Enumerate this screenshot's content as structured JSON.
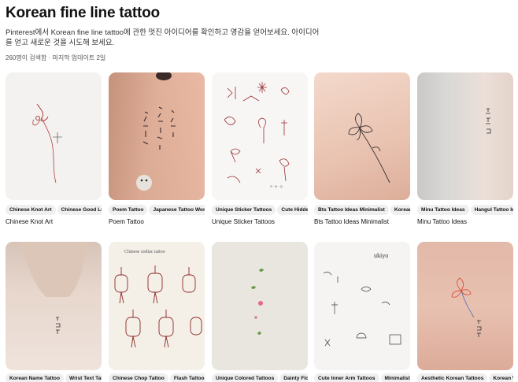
{
  "header": {
    "title": "Korean fine line tattoo",
    "description": "Pinterest에서 Korean fine line tattoo에 관한 멋진 아이디어를 확인하고 영감을 얻어보세요. 아이디어를 얻고 새로운 것을 시도해 보세요.",
    "meta": "260명이 검색함 · 마지막 업데이트 2일"
  },
  "cards": [
    {
      "chips": [
        "Chinese Knot Art",
        "Chinese Good Luck"
      ],
      "label": "Chinese Knot Art"
    },
    {
      "chips": [
        "Poem Tattoo",
        "Japanese Tattoo Words"
      ],
      "label": "Poem Tattoo"
    },
    {
      "chips": [
        "Unique Sticker Tattoos",
        "Cute Hidden"
      ],
      "label": "Unique Sticker Tattoos"
    },
    {
      "chips": [
        "Bts Tattoo Ideas Minimalist",
        "Korean"
      ],
      "label": "Bts Tattoo Ideas Minimalist"
    },
    {
      "chips": [
        "Minu Tattoo Ideas",
        "Hangul Tattoo Ideas"
      ],
      "label": "Minu Tattoo Ideas"
    },
    {
      "chips": [
        "Korean Name Tattoo",
        "Wrist Text Tattoo"
      ],
      "label": ""
    },
    {
      "chips": [
        "Chinese Chop Tattoo",
        "Flash Tattoo"
      ],
      "label": ""
    },
    {
      "chips": [
        "Unique Colored Tattoos",
        "Dainty Flower"
      ],
      "label": ""
    },
    {
      "chips": [
        "Cute Inner Arm Tattoos",
        "Minimalist"
      ],
      "label": ""
    },
    {
      "chips": [
        "Aesthetic Korean Tattoos",
        "Korean Words"
      ],
      "label": ""
    }
  ],
  "images": {
    "card3_tag": "ukiyo",
    "card6_tag": "Chinese zodiac tattoo"
  }
}
